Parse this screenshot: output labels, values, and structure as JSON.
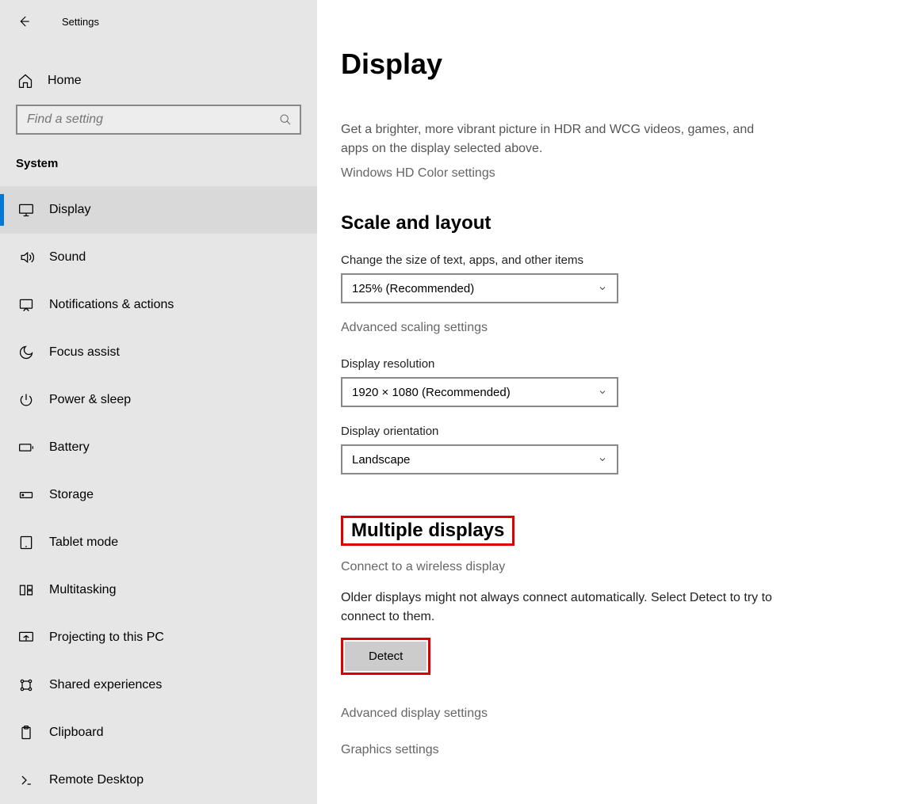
{
  "window_title": "Settings",
  "home_label": "Home",
  "search_placeholder": "Find a setting",
  "category": "System",
  "nav": [
    {
      "label": "Display"
    },
    {
      "label": "Sound"
    },
    {
      "label": "Notifications & actions"
    },
    {
      "label": "Focus assist"
    },
    {
      "label": "Power & sleep"
    },
    {
      "label": "Battery"
    },
    {
      "label": "Storage"
    },
    {
      "label": "Tablet mode"
    },
    {
      "label": "Multitasking"
    },
    {
      "label": "Projecting to this PC"
    },
    {
      "label": "Shared experiences"
    },
    {
      "label": "Clipboard"
    },
    {
      "label": "Remote Desktop"
    }
  ],
  "main": {
    "title": "Display",
    "intro": "Get a brighter, more vibrant picture in HDR and WCG videos, games, and apps on the display selected above.",
    "hd_color_link": "Windows HD Color settings",
    "scale_heading": "Scale and layout",
    "scale_label": "Change the size of text, apps, and other items",
    "scale_value": "125% (Recommended)",
    "scaling_link": "Advanced scaling settings",
    "resolution_label": "Display resolution",
    "resolution_value": "1920 × 1080 (Recommended)",
    "orientation_label": "Display orientation",
    "orientation_value": "Landscape",
    "multi_heading": "Multiple displays",
    "wireless_link": "Connect to a wireless display",
    "detect_text": "Older displays might not always connect automatically. Select Detect to try to connect to them.",
    "detect_button": "Detect",
    "advanced_display_link": "Advanced display settings",
    "graphics_link": "Graphics settings"
  }
}
